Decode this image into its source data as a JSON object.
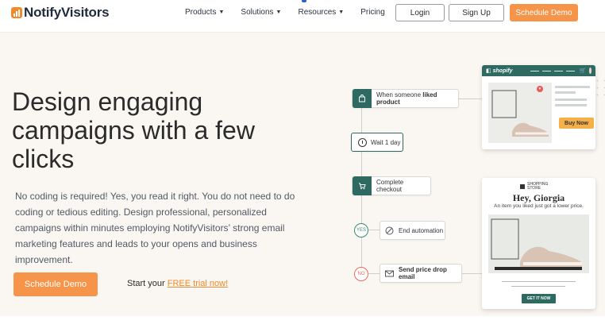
{
  "nav": {
    "logo": "NotifyVisitors",
    "menu": [
      {
        "label": "Products"
      },
      {
        "label": "Solutions"
      },
      {
        "label": "Resources"
      },
      {
        "label": "Pricing"
      }
    ],
    "login": "Login",
    "signup": "Sign Up",
    "demo": "Schedule Demo"
  },
  "hero": {
    "headline": "Design engaging campaigns with a few clicks",
    "description": "No coding is required! Yes, you read it right. You do not need to do coding or tedious editing. Design professional, personalized campaigns within minutes employing NotifyVisitors’ strong email marketing features and leads to your opens and business improvement.",
    "cta": "Schedule Demo",
    "trial_prefix": "Start your ",
    "trial_link": "FREE trial now!"
  },
  "flow": {
    "step1_prefix": "When someone ",
    "step1_bold": "liked product",
    "step2": "Wait 1 day",
    "step3": "Complete checkout",
    "yes": "YES",
    "step4": "End automation",
    "no": "NO",
    "step5": "Send price drop email"
  },
  "shop_card": {
    "brand": "shopify",
    "buy": "Buy Now"
  },
  "mail_card": {
    "brand_line1": "SHOPPING",
    "brand_line2": "STORE",
    "title": "Hey, Giorgia",
    "subtitle": "An item you liked just got a lower price.",
    "cta": "GET IT NOW"
  },
  "colors": {
    "accent": "#f6944a",
    "teal": "#2e6a62",
    "hero_bg": "#faf6f1"
  }
}
